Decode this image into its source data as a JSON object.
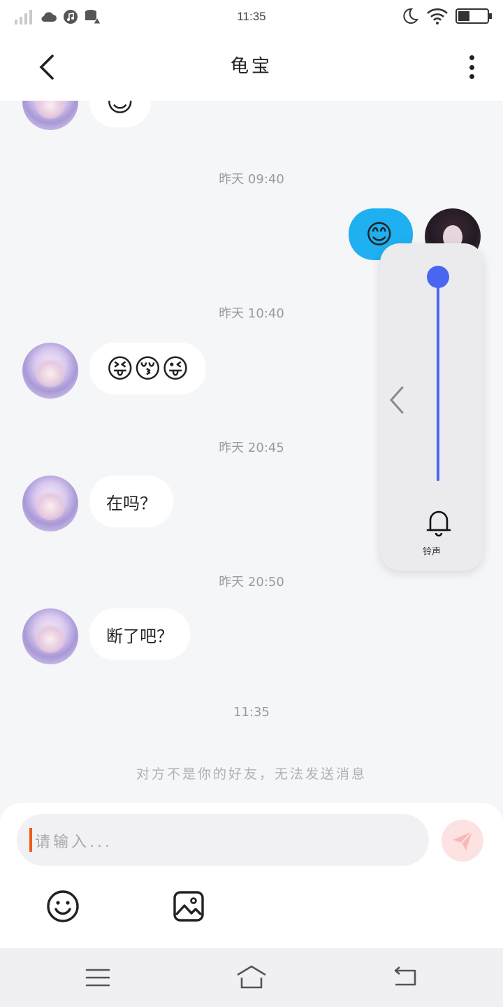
{
  "status_bar": {
    "time": "11:35",
    "icons": [
      "signal-icon",
      "cloud-icon",
      "music-icon",
      "storage-alert-icon",
      "moon-icon",
      "wifi-icon",
      "battery-icon"
    ]
  },
  "header": {
    "title": "龟宝",
    "back_icon": "chevron-left-icon",
    "more_icon": "more-vertical-icon"
  },
  "chat": {
    "messages": [
      {
        "sender": "friend",
        "content": "😊"
      },
      {
        "timestamp": "昨天 09:40"
      },
      {
        "sender": "me",
        "content": "😊"
      },
      {
        "timestamp": "昨天 10:40"
      },
      {
        "sender": "friend",
        "content": "😝😚😜"
      },
      {
        "timestamp": "昨天 20:45"
      },
      {
        "sender": "friend",
        "content": "在吗？"
      },
      {
        "timestamp": "昨天 20:50"
      },
      {
        "sender": "friend",
        "content": "断了吧？"
      },
      {
        "timestamp": "11:35"
      }
    ],
    "system_note": "对方不是你的好友，无法发送消息"
  },
  "volume_panel": {
    "label": "铃声",
    "level": 1.0,
    "accent": "#4a66f0",
    "icons": [
      "chevron-left-icon",
      "bell-icon"
    ]
  },
  "input": {
    "placeholder": "请输入...",
    "send_icon": "paper-plane-icon",
    "tools": [
      "smile-icon",
      "image-icon"
    ]
  },
  "nav_bar": {
    "icons": [
      "menu-icon",
      "home-icon",
      "back-return-icon"
    ]
  },
  "colors": {
    "accent_blue": "#1eb0f0",
    "caret": "#f05a1a",
    "send_disabled": "#fde2e2"
  }
}
